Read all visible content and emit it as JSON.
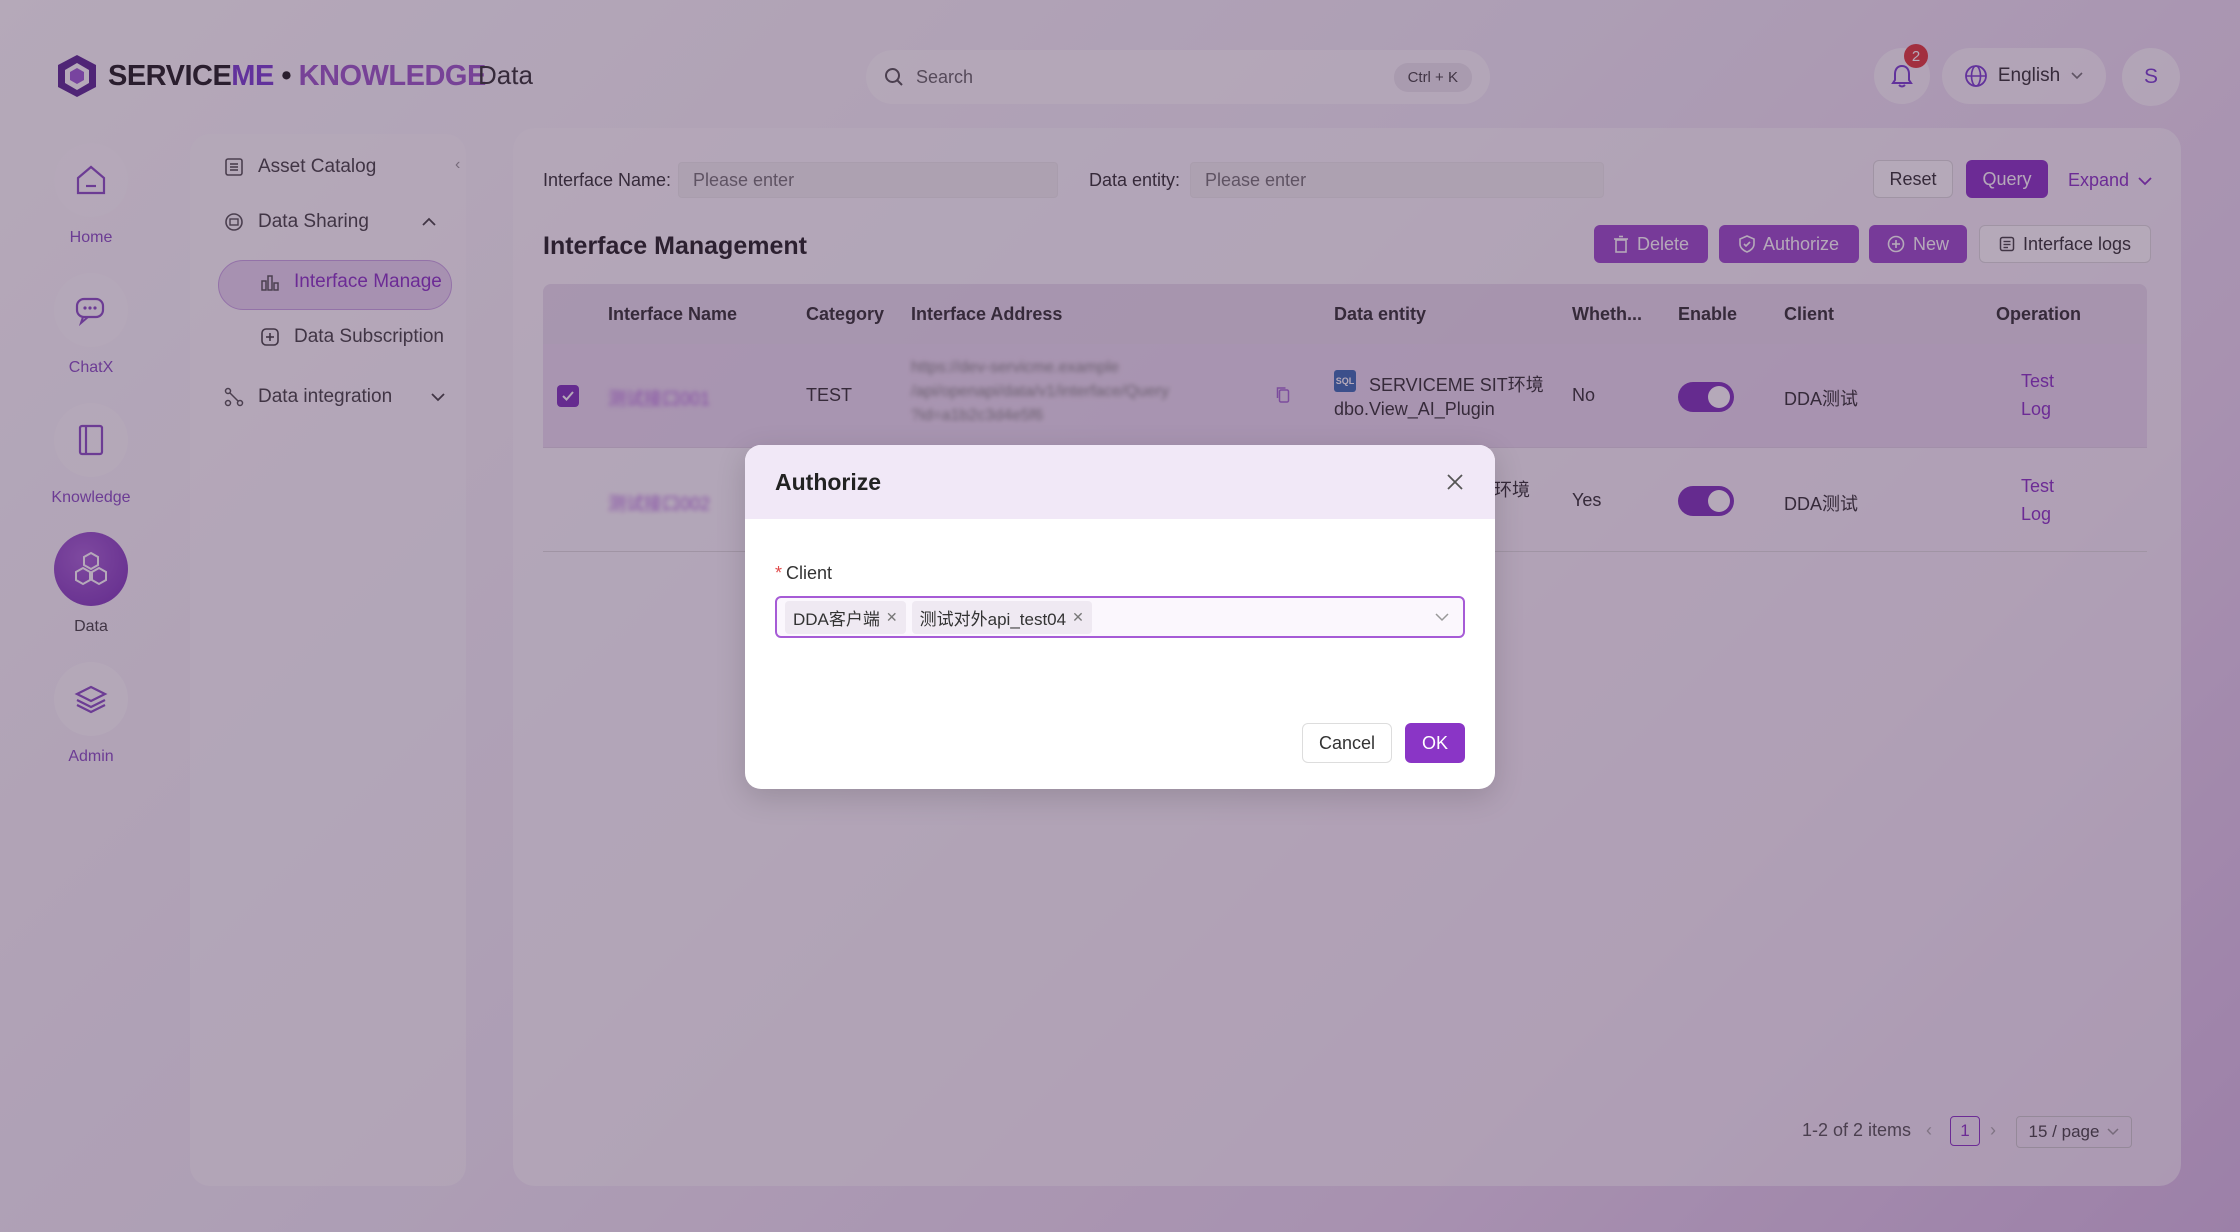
{
  "app": {
    "logo_text_1": "SERVICE",
    "logo_text_2": "ME",
    "logo_sep": " • ",
    "logo_text_3": "KNOWLEDGE",
    "section": "Data"
  },
  "search": {
    "placeholder": "Search",
    "shortcut": "Ctrl + K"
  },
  "notifications": {
    "count": "2"
  },
  "language": {
    "label": "English"
  },
  "user": {
    "initial": "S"
  },
  "rail": [
    {
      "label": "Home",
      "icon": "home-icon"
    },
    {
      "label": "ChatX",
      "icon": "chat-icon"
    },
    {
      "label": "Knowledge",
      "icon": "book-icon"
    },
    {
      "label": "Data",
      "icon": "hexagon-cluster-icon"
    },
    {
      "label": "Admin",
      "icon": "layers-icon"
    }
  ],
  "sidenav": {
    "asset_catalog": "Asset Catalog",
    "data_sharing": "Data Sharing",
    "interface_manage": "Interface Manage",
    "data_subscription": "Data Subscription",
    "data_integration": "Data integration"
  },
  "filters": {
    "interface_name_label": "Interface Name:",
    "interface_name_placeholder": "Please enter",
    "data_entity_label": "Data entity:",
    "data_entity_placeholder": "Please enter",
    "reset": "Reset",
    "query": "Query",
    "expand": "Expand"
  },
  "page": {
    "title": "Interface Management",
    "delete": "Delete",
    "authorize": "Authorize",
    "new": "New",
    "interface_logs": "Interface logs"
  },
  "table": {
    "columns": [
      "Interface Name",
      "Category",
      "Interface Address",
      "Data entity",
      "Wheth...",
      "Enable",
      "Client",
      "Operation"
    ],
    "rows": [
      {
        "name": "测试接口001",
        "category": "TEST",
        "address_1": "https://dev-servicme.example",
        "address_2": "/api/openapi/data/v1/interface/Query",
        "address_3": "?id=a1b2c3d4e5f6",
        "entity_1": "SERVICEME SIT环境",
        "entity_2": "dbo.View_AI_Plugin",
        "whether": "No",
        "enabled": true,
        "client": "DDA测试",
        "op_1": "Test",
        "op_2": "Log"
      },
      {
        "name": "测试接口002",
        "category": "",
        "entity_1": "环境",
        "whether": "Yes",
        "enabled": true,
        "client": "DDA测试",
        "op_1": "Test",
        "op_2": "Log"
      }
    ]
  },
  "pagination": {
    "summary": "1-2 of 2 items",
    "page": "1",
    "page_size": "15 / page"
  },
  "modal": {
    "title": "Authorize",
    "field_label": "Client",
    "tags": [
      "DDA客户端",
      "测试对外api_test04"
    ],
    "cancel": "Cancel",
    "ok": "OK"
  },
  "colors": {
    "accent": "#8a35c6",
    "badge": "#e03b3b"
  }
}
